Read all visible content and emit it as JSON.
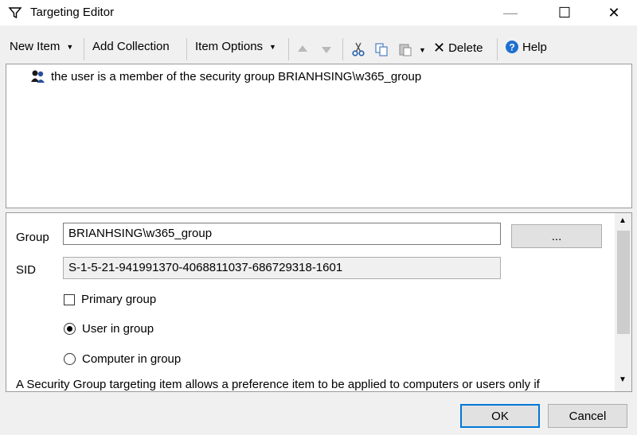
{
  "window": {
    "title": "Targeting Editor",
    "controls": {
      "minimize": "—",
      "maximize": "☐",
      "close": "✕"
    }
  },
  "toolbar": {
    "new_item": "New Item",
    "add_collection": "Add Collection",
    "item_options": "Item Options",
    "delete": "Delete",
    "help": "Help",
    "icons": [
      "arrow-up-icon",
      "arrow-down-icon",
      "cut-icon",
      "copy-icon",
      "paste-icon",
      "delete-icon",
      "help-icon"
    ]
  },
  "tree": {
    "items": [
      {
        "label": "the user is a member of the security group BRIANHSING\\w365_group",
        "icon": "security-group-icon"
      }
    ]
  },
  "properties": {
    "group_label": "Group",
    "group_value": "BRIANHSING\\w365_group",
    "browse_label": "...",
    "sid_label": "SID",
    "sid_value": "S-1-5-21-941991370-4068811037-686729318-1601",
    "primary_group_label": "Primary group",
    "primary_group_checked": false,
    "user_in_group_label": "User in group",
    "computer_in_group_label": "Computer in group",
    "selected_option": "User in group",
    "description": "A Security Group targeting item allows a preference item to be applied to computers or users only if"
  },
  "footer": {
    "ok": "OK",
    "cancel": "Cancel"
  },
  "colors": {
    "accent": "#0078d7",
    "help_icon": "#1e6fd0"
  }
}
